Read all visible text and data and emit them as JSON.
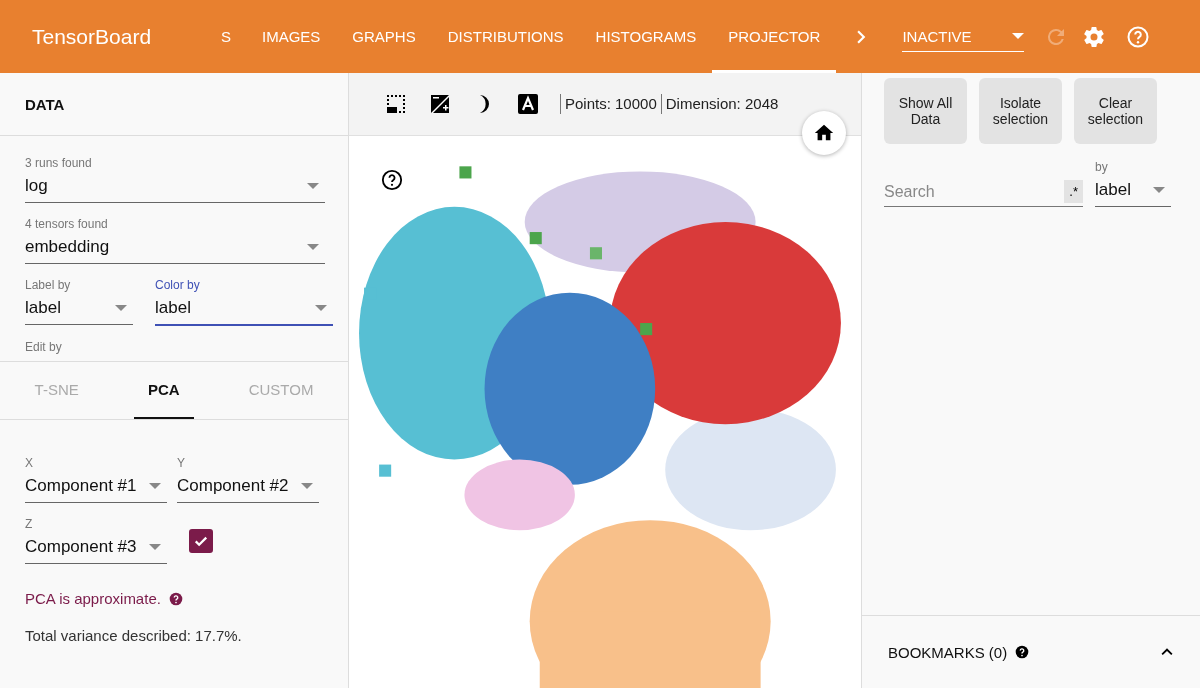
{
  "header": {
    "title": "TensorBoard",
    "tabs": [
      {
        "label": "S",
        "selected": false
      },
      {
        "label": "IMAGES",
        "selected": false
      },
      {
        "label": "GRAPHS",
        "selected": false
      },
      {
        "label": "DISTRIBUTIONS",
        "selected": false
      },
      {
        "label": "HISTOGRAMS",
        "selected": false
      },
      {
        "label": "PROJECTOR",
        "selected": true
      }
    ],
    "run_select": {
      "value": "INACTIVE"
    },
    "reload": {
      "disabled": true
    }
  },
  "data_panel": {
    "title": "DATA",
    "fields": [
      {
        "label": "3 runs found",
        "value": "log",
        "focused": false
      },
      {
        "label": "4 tensors found",
        "value": "embedding",
        "focused": false
      }
    ],
    "pair": [
      {
        "label": "Label by",
        "value": "label",
        "focused": false
      },
      {
        "label": "Color by",
        "value": "label",
        "focused": true
      }
    ],
    "edit_by": {
      "label": "Edit by"
    }
  },
  "projection_tabs": [
    {
      "label": "T-SNE",
      "selected": false
    },
    {
      "label": "PCA",
      "selected": true
    },
    {
      "label": "CUSTOM",
      "selected": false
    }
  ],
  "pca": {
    "axes": [
      {
        "label": "X",
        "value": "Component #1"
      },
      {
        "label": "Y",
        "value": "Component #2"
      },
      {
        "label": "Z",
        "value": "Component #3"
      }
    ],
    "z_checkbox": {
      "checked": true
    },
    "warning": "PCA is approximate.",
    "variance": "Total variance described: 17.7%."
  },
  "toolbar": {
    "points": "Points: 10000",
    "dimension": "Dimension: 2048"
  },
  "inspector": {
    "buttons": [
      {
        "label": "Show All Data"
      },
      {
        "label": "Isolate selection"
      },
      {
        "label": "Clear selection"
      }
    ],
    "search": {
      "placeholder": "Search",
      "regex": {
        "label": ".*",
        "selected": false
      }
    },
    "by": {
      "label": "by",
      "value": "label"
    }
  },
  "bookmarks": {
    "title": "BOOKMARKS (0)"
  }
}
